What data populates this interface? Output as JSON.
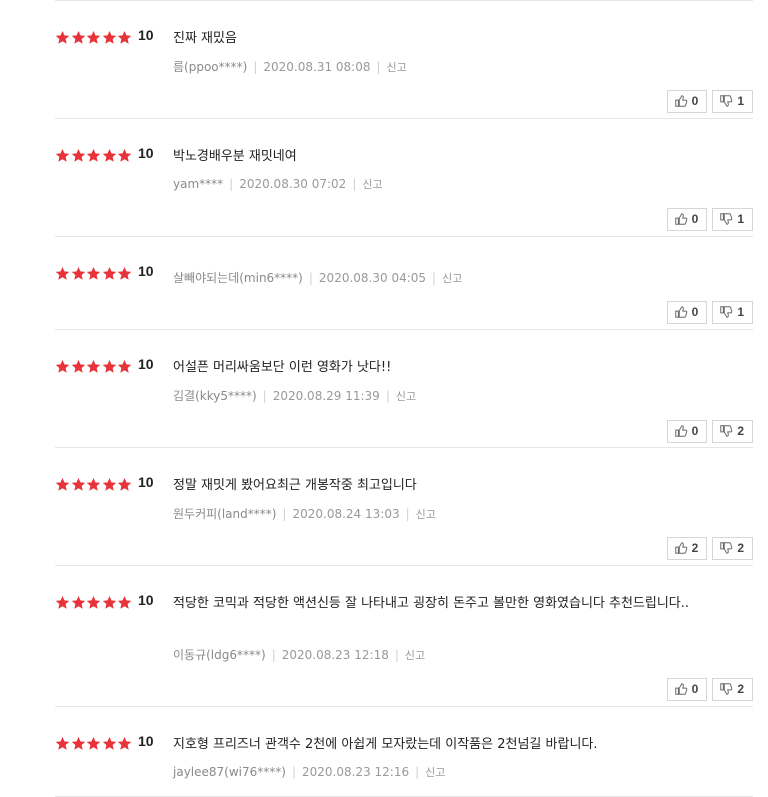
{
  "colors": {
    "star": "#e8333b",
    "border": "#e6e6e6"
  },
  "icons": {
    "star": "star-icon",
    "like": "thumbs-up-icon",
    "dislike": "thumbs-down-icon"
  },
  "reviews": [
    {
      "score": "10",
      "text": "진짜 재밌음",
      "author": "름(ppoo****)",
      "date": "2020.08.31 08:08",
      "report": "신고",
      "likes": "0",
      "dislikes": "1"
    },
    {
      "score": "10",
      "text": "박노경배우분 재밋네여",
      "author": "yam****",
      "date": "2020.08.30 07:02",
      "report": "신고",
      "likes": "0",
      "dislikes": "1"
    },
    {
      "score": "10",
      "text": "",
      "author": "살빼야되는데(min6****)",
      "date": "2020.08.30 04:05",
      "report": "신고",
      "likes": "0",
      "dislikes": "1"
    },
    {
      "score": "10",
      "text": "어설픈 머리싸움보단 이런 영화가 낫다!!",
      "author": "김결(kky5****)",
      "date": "2020.08.29 11:39",
      "report": "신고",
      "likes": "0",
      "dislikes": "2"
    },
    {
      "score": "10",
      "text": "정말 재밋게 봤어요최근 개봉작중 최고입니다",
      "author": "원두커피(land****)",
      "date": "2020.08.24 13:03",
      "report": "신고",
      "likes": "2",
      "dislikes": "2"
    },
    {
      "score": "10",
      "text": "적당한 코믹과 적당한 액션신등 잘 나타내고 굉장히 돈주고 볼만한 영화였습니다 추천드립니다..",
      "author": "이동규(ldg6****)",
      "date": "2020.08.23 12:18",
      "report": "신고",
      "likes": "0",
      "dislikes": "2"
    },
    {
      "score": "10",
      "text": "지호형 프리즈너 관객수 2천에 아쉽게 모자랐는데 이작품은 2천넘길 바랍니다.",
      "author": "jaylee87(wi76****)",
      "date": "2020.08.23 12:16",
      "report": "신고",
      "likes": "",
      "dislikes": ""
    }
  ]
}
